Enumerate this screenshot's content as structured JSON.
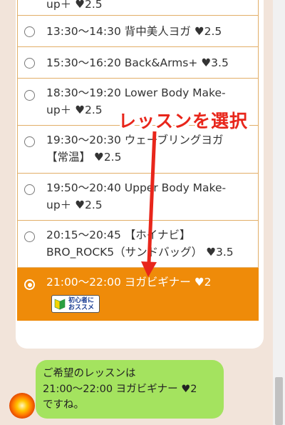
{
  "annotation": {
    "label": "レッスンを選択"
  },
  "lessons": [
    {
      "lines": [
        "up＋ ♥2.5"
      ],
      "selected": false,
      "partial": true
    },
    {
      "lines": [
        "13:30〜14:30 背中美人ヨガ ♥2.5"
      ],
      "selected": false
    },
    {
      "lines": [
        "15:30〜16:20 Back&Arms+ ♥3.5"
      ],
      "selected": false
    },
    {
      "lines": [
        "18:30〜19:20 Lower Body Make-",
        "up＋ ♥2.5"
      ],
      "selected": false
    },
    {
      "lines": [
        "19:30〜20:30 ウェーブリングヨガ",
        "【常温】 ♥2.5"
      ],
      "selected": false
    },
    {
      "lines": [
        "19:50〜20:40 Upper Body Make-",
        "up＋ ♥2.5"
      ],
      "selected": false
    },
    {
      "lines": [
        "20:15〜20:45 【ホイナビ】",
        "BRO_ROCK5（サンドバッグ） ♥3.5"
      ],
      "selected": false
    },
    {
      "lines": [
        "21:00〜22:00 ヨガビギナー ♥2"
      ],
      "selected": true,
      "badge": {
        "line1": "初心者に",
        "line2": "おススメ"
      }
    }
  ],
  "chat": {
    "bubble_lines": [
      "ご希望のレッスンは",
      "21:00〜22:00 ヨガビギナー ♥2",
      "ですね。"
    ]
  },
  "colors": {
    "selected_row": "#ef8b09",
    "row_border": "#e2ae68",
    "bubble": "#a4e35f",
    "annotation": "#e8261b",
    "background": "#f2e4da"
  }
}
